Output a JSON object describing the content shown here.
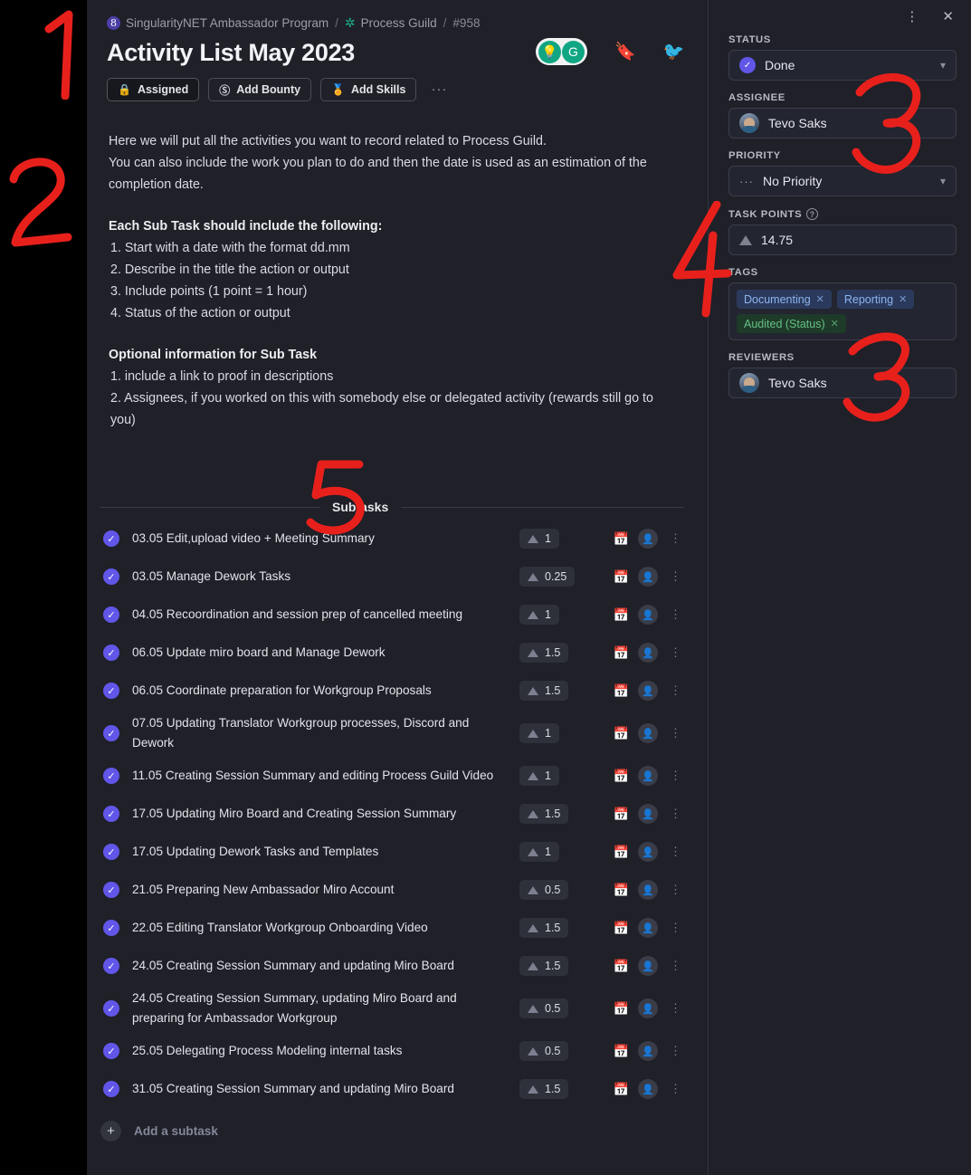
{
  "window": {
    "menu_icon": "kebab-vertical-icon",
    "close_icon": "close-icon"
  },
  "breadcrumb": {
    "org": "SingularityNET Ambassador Program",
    "org_icon": "singularitynet-logo-icon",
    "project": "Process Guild",
    "project_icon": "puzzle-piece-icon",
    "sep": "/",
    "task_number": "#958"
  },
  "header": {
    "title": "Activity List May 2023",
    "grammarly_icon": "grammarly-widget",
    "bulb_icon": "lightbulb-icon",
    "g_icon": "grammarly-g-icon",
    "bookmark_icon": "bookmark-icon",
    "twitter_icon": "twitter-icon"
  },
  "actions": {
    "assigned_label": "Assigned",
    "assigned_icon": "lock-icon",
    "bounty_label": "Add Bounty",
    "bounty_icon": "dollar-circle-icon",
    "skills_label": "Add Skills",
    "skills_icon": "medal-icon",
    "more_label": "···"
  },
  "description": {
    "para1_line1": "Here we will put all the activities you want to record related to Process Guild.",
    "para1_line2": "You can also include the work you plan to do and then the date is used as an estimation of the",
    "para1_line3": "completion date.",
    "heading1": "Each Sub Task should include the following:",
    "list1": [
      "1. Start with a date with the format dd.mm",
      "2. Describe in the title the action or output",
      "3. Include points (1 point = 1 hour)",
      "4. Status of the action or output"
    ],
    "heading2": "Optional information for Sub Task",
    "list2": [
      "1. include a link to proof in descriptions",
      "2. Assignees, if you worked on this with somebody else or delegated activity (rewards still go to you)"
    ]
  },
  "subtasks_section": {
    "label": "Subtasks",
    "add_label": "Add a subtask",
    "add_icon": "plus-icon",
    "check_icon": "check-icon",
    "calendar_icon": "calendar-icon",
    "assign_icon": "add-person-icon",
    "kebab_icon": "kebab-vertical-icon",
    "items": [
      {
        "title": "03.05 Edit,upload video + Meeting Summary",
        "points": "1",
        "done": true
      },
      {
        "title": "03.05 Manage Dework Tasks",
        "points": "0.25",
        "done": true
      },
      {
        "title": "04.05 Recoordination and session prep of cancelled meeting",
        "points": "1",
        "done": true
      },
      {
        "title": "06.05 Update miro board and Manage Dework",
        "points": "1.5",
        "done": true
      },
      {
        "title": "06.05 Coordinate preparation for Workgroup Proposals",
        "points": "1.5",
        "done": true
      },
      {
        "title": "07.05 Updating Translator Workgroup processes, Discord and Dework",
        "points": "1",
        "done": true
      },
      {
        "title": "11.05 Creating Session Summary and editing Process Guild Video",
        "points": "1",
        "done": true
      },
      {
        "title": "17.05 Updating Miro Board and Creating Session Summary",
        "points": "1.5",
        "done": true
      },
      {
        "title": "17.05 Updating Dework Tasks and Templates",
        "points": "1",
        "done": true
      },
      {
        "title": "21.05 Preparing New Ambassador Miro Account",
        "points": "0.5",
        "done": true
      },
      {
        "title": "22.05 Editing Translator Workgroup Onboarding Video",
        "points": "1.5",
        "done": true
      },
      {
        "title": "24.05 Creating Session Summary and updating Miro Board",
        "points": "1.5",
        "done": true
      },
      {
        "title": "24.05 Creating Session Summary, updating Miro Board and preparing for Ambassador Workgroup",
        "points": "0.5",
        "done": true
      },
      {
        "title": "25.05 Delegating Process Modeling internal tasks",
        "points": "0.5",
        "done": true
      },
      {
        "title": "31.05 Creating Session Summary and updating Miro Board",
        "points": "1.5",
        "done": true
      }
    ]
  },
  "sidebar": {
    "status": {
      "label": "STATUS",
      "value": "Done",
      "icon": "check-circle-icon",
      "chevron": "chevron-down-icon"
    },
    "assignee": {
      "label": "ASSIGNEE",
      "value": "Tevo Saks",
      "avatar": "user-avatar"
    },
    "priority": {
      "label": "PRIORITY",
      "value": "No Priority",
      "icon": "no-priority-icon",
      "chevron": "chevron-down-icon"
    },
    "task_points": {
      "label": "TASK POINTS",
      "help_icon": "help-circle-icon",
      "value": "14.75",
      "icon": "triangle-points-icon"
    },
    "tags": {
      "label": "TAGS",
      "items": [
        {
          "text": "Documenting",
          "color": "blue"
        },
        {
          "text": "Reporting",
          "color": "blue"
        },
        {
          "text": "Audited (Status)",
          "color": "green"
        }
      ],
      "remove_icon": "close-small-icon"
    },
    "reviewers": {
      "label": "REVIEWERS",
      "value": "Tevo Saks",
      "avatar": "user-avatar"
    }
  },
  "annotations": {
    "a1": "1",
    "a2": "2",
    "a3": "3",
    "a4": "4",
    "a5": "5",
    "a6": "3",
    "color": "#e8201c"
  }
}
